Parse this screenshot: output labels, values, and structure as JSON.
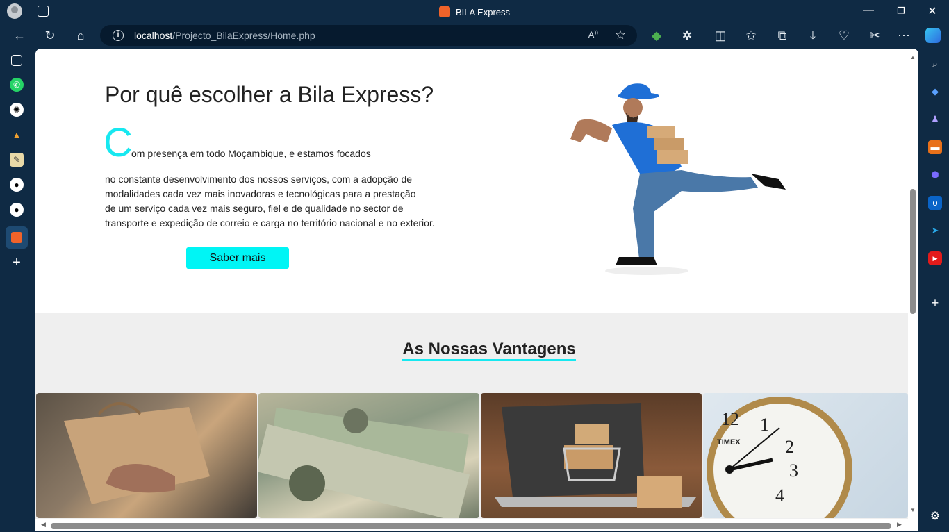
{
  "window": {
    "title": "BILA Express",
    "minimize": "—",
    "maximize": "❐",
    "close": "✕"
  },
  "toolbar": {
    "url_host": "localhost",
    "url_path": "/Projecto_BilaExpress/Home.php",
    "read_aloud": "A ͡"
  },
  "hero": {
    "title": "Por quê escolher a Bila Express?",
    "dropcap": "C",
    "lead": "om presença em todo Moçambique, e estamos focados",
    "lines": [
      "no constante desenvolvimento dos nossos serviços, com a adopção de",
      "modalidades cada vez mais inovadoras e tecnológicas para a prestação",
      "de um serviço cada vez mais seguro, fiel e de qualidade no sector de",
      "transporte e expedição de correio e carga no território nacional e no exterior."
    ],
    "button": "Saber mais"
  },
  "vantagens": {
    "title": "As Nossas Vantagens"
  },
  "colors": {
    "accent": "#00f5f5",
    "browser_chrome": "#0f2a44",
    "section_bg": "#efefef"
  },
  "icons": {
    "left": [
      "workspaces-icon",
      "whatsapp-icon",
      "chatgpt-icon",
      "app-icon",
      "app-icon",
      "github-icon",
      "github-icon",
      "xampp-icon",
      "add-icon"
    ],
    "right": [
      "search-icon",
      "tag-icon",
      "games-icon",
      "tools-icon",
      "copilot-icon",
      "outlook-icon",
      "send-icon",
      "youtube-icon",
      "add-icon",
      "settings-icon"
    ]
  }
}
